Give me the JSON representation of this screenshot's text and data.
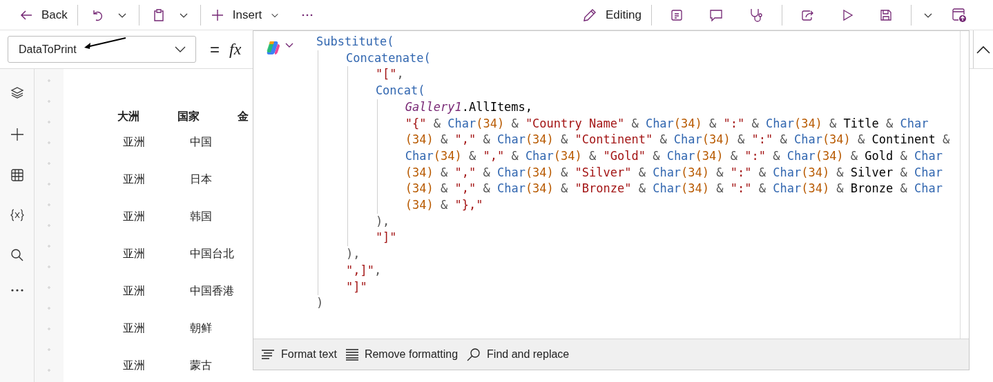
{
  "toolbar": {
    "back": "Back",
    "insert": "Insert",
    "mode": "Editing"
  },
  "formula_bar": {
    "property": "DataToPrint",
    "equals": "=",
    "fx": "fx"
  },
  "canvas": {
    "columns": [
      "大洲",
      "国家",
      "金"
    ],
    "rows": [
      [
        "亚洲",
        "中国"
      ],
      [
        "亚洲",
        "日本"
      ],
      [
        "亚洲",
        "韩国"
      ],
      [
        "亚洲",
        "中国台北"
      ],
      [
        "亚洲",
        "中国香港"
      ],
      [
        "亚洲",
        "朝鲜"
      ],
      [
        "亚洲",
        "蒙古"
      ]
    ]
  },
  "code": [
    {
      "tokens": [
        {
          "kind": "fn",
          "text": "Substitute("
        }
      ],
      "children": [
        {
          "tokens": [
            {
              "kind": "fn",
              "text": "Concatenate("
            }
          ],
          "children": [
            {
              "tokens": [
                {
                  "kind": "str",
                  "text": "\"[\""
                },
                {
                  "kind": "op",
                  "text": ","
                }
              ]
            },
            {
              "tokens": [
                {
                  "kind": "fn",
                  "text": "Concat("
                }
              ],
              "children": [
                {
                  "tokens": [
                    {
                      "kind": "ref",
                      "text": "Gallery1"
                    },
                    {
                      "kind": "plain",
                      "text": ".AllItems,"
                    }
                  ]
                },
                {
                  "tokens": [
                    {
                      "kind": "str",
                      "text": "\"{\""
                    },
                    {
                      "kind": "op",
                      "text": " & "
                    },
                    {
                      "kind": "fn",
                      "text": "Char"
                    },
                    {
                      "kind": "num",
                      "text": "(34)"
                    },
                    {
                      "kind": "op",
                      "text": " & "
                    },
                    {
                      "kind": "str",
                      "text": "\"Country Name\""
                    },
                    {
                      "kind": "op",
                      "text": " & "
                    },
                    {
                      "kind": "fn",
                      "text": "Char"
                    },
                    {
                      "kind": "num",
                      "text": "(34)"
                    },
                    {
                      "kind": "op",
                      "text": " & "
                    },
                    {
                      "kind": "str",
                      "text": "\":\""
                    },
                    {
                      "kind": "op",
                      "text": " & "
                    },
                    {
                      "kind": "fn",
                      "text": "Char"
                    },
                    {
                      "kind": "num",
                      "text": "(34)"
                    },
                    {
                      "kind": "op",
                      "text": " & "
                    },
                    {
                      "kind": "plain",
                      "text": "Title"
                    },
                    {
                      "kind": "op",
                      "text": " & "
                    },
                    {
                      "kind": "fn",
                      "text": "Char"
                    },
                    {
                      "kind": "num",
                      "text": "(34)"
                    },
                    {
                      "kind": "op",
                      "text": " & "
                    },
                    {
                      "kind": "str",
                      "text": "\",\""
                    },
                    {
                      "kind": "op",
                      "text": " & "
                    },
                    {
                      "kind": "fn",
                      "text": "Char"
                    },
                    {
                      "kind": "num",
                      "text": "(34)"
                    },
                    {
                      "kind": "op",
                      "text": " & "
                    },
                    {
                      "kind": "str",
                      "text": "\"Continent\""
                    },
                    {
                      "kind": "op",
                      "text": " & "
                    },
                    {
                      "kind": "fn",
                      "text": "Char"
                    },
                    {
                      "kind": "num",
                      "text": "(34)"
                    },
                    {
                      "kind": "op",
                      "text": " & "
                    },
                    {
                      "kind": "str",
                      "text": "\":\""
                    },
                    {
                      "kind": "op",
                      "text": " & "
                    },
                    {
                      "kind": "fn",
                      "text": "Char"
                    },
                    {
                      "kind": "num",
                      "text": "(34)"
                    },
                    {
                      "kind": "op",
                      "text": " & "
                    },
                    {
                      "kind": "plain",
                      "text": "Continent"
                    },
                    {
                      "kind": "op",
                      "text": " & "
                    },
                    {
                      "kind": "fn",
                      "text": "Char"
                    },
                    {
                      "kind": "num",
                      "text": "(34)"
                    },
                    {
                      "kind": "op",
                      "text": " & "
                    },
                    {
                      "kind": "str",
                      "text": "\",\""
                    },
                    {
                      "kind": "op",
                      "text": " & "
                    },
                    {
                      "kind": "fn",
                      "text": "Char"
                    },
                    {
                      "kind": "num",
                      "text": "(34)"
                    },
                    {
                      "kind": "op",
                      "text": " & "
                    },
                    {
                      "kind": "str",
                      "text": "\"Gold\""
                    },
                    {
                      "kind": "op",
                      "text": " & "
                    },
                    {
                      "kind": "fn",
                      "text": "Char"
                    },
                    {
                      "kind": "num",
                      "text": "(34)"
                    },
                    {
                      "kind": "op",
                      "text": " & "
                    },
                    {
                      "kind": "str",
                      "text": "\":\""
                    },
                    {
                      "kind": "op",
                      "text": " & "
                    },
                    {
                      "kind": "fn",
                      "text": "Char"
                    },
                    {
                      "kind": "num",
                      "text": "(34)"
                    },
                    {
                      "kind": "op",
                      "text": " & "
                    },
                    {
                      "kind": "plain",
                      "text": "Gold"
                    },
                    {
                      "kind": "op",
                      "text": " & "
                    },
                    {
                      "kind": "fn",
                      "text": "Char"
                    },
                    {
                      "kind": "num",
                      "text": "(34)"
                    },
                    {
                      "kind": "op",
                      "text": " & "
                    },
                    {
                      "kind": "str",
                      "text": "\",\""
                    },
                    {
                      "kind": "op",
                      "text": " & "
                    },
                    {
                      "kind": "fn",
                      "text": "Char"
                    },
                    {
                      "kind": "num",
                      "text": "(34)"
                    },
                    {
                      "kind": "op",
                      "text": " & "
                    },
                    {
                      "kind": "str",
                      "text": "\"Silver\""
                    },
                    {
                      "kind": "op",
                      "text": " & "
                    },
                    {
                      "kind": "fn",
                      "text": "Char"
                    },
                    {
                      "kind": "num",
                      "text": "(34)"
                    },
                    {
                      "kind": "op",
                      "text": " & "
                    },
                    {
                      "kind": "str",
                      "text": "\":\""
                    },
                    {
                      "kind": "op",
                      "text": " & "
                    },
                    {
                      "kind": "fn",
                      "text": "Char"
                    },
                    {
                      "kind": "num",
                      "text": "(34)"
                    },
                    {
                      "kind": "op",
                      "text": " & "
                    },
                    {
                      "kind": "plain",
                      "text": "Silver"
                    },
                    {
                      "kind": "op",
                      "text": " & "
                    },
                    {
                      "kind": "fn",
                      "text": "Char"
                    },
                    {
                      "kind": "num",
                      "text": "(34)"
                    },
                    {
                      "kind": "op",
                      "text": " & "
                    },
                    {
                      "kind": "str",
                      "text": "\",\""
                    },
                    {
                      "kind": "op",
                      "text": " & "
                    },
                    {
                      "kind": "fn",
                      "text": "Char"
                    },
                    {
                      "kind": "num",
                      "text": "(34)"
                    },
                    {
                      "kind": "op",
                      "text": " & "
                    },
                    {
                      "kind": "str",
                      "text": "\"Bronze\""
                    },
                    {
                      "kind": "op",
                      "text": " & "
                    },
                    {
                      "kind": "fn",
                      "text": "Char"
                    },
                    {
                      "kind": "num",
                      "text": "(34)"
                    },
                    {
                      "kind": "op",
                      "text": " & "
                    },
                    {
                      "kind": "str",
                      "text": "\":\""
                    },
                    {
                      "kind": "op",
                      "text": " & "
                    },
                    {
                      "kind": "fn",
                      "text": "Char"
                    },
                    {
                      "kind": "num",
                      "text": "(34)"
                    },
                    {
                      "kind": "op",
                      "text": " & "
                    },
                    {
                      "kind": "plain",
                      "text": "Bronze"
                    },
                    {
                      "kind": "op",
                      "text": " & "
                    },
                    {
                      "kind": "fn",
                      "text": "Char"
                    },
                    {
                      "kind": "num",
                      "text": "(34)"
                    },
                    {
                      "kind": "op",
                      "text": " & "
                    },
                    {
                      "kind": "str",
                      "text": "\"},\""
                    }
                  ]
                }
              ]
            },
            {
              "tokens": [
                {
                  "kind": "op",
                  "text": "),"
                }
              ]
            },
            {
              "tokens": [
                {
                  "kind": "str",
                  "text": "\"]\""
                }
              ]
            }
          ]
        },
        {
          "tokens": [
            {
              "kind": "op",
              "text": "),"
            }
          ]
        },
        {
          "tokens": [
            {
              "kind": "str",
              "text": "\",]\""
            },
            {
              "kind": "op",
              "text": ","
            }
          ]
        },
        {
          "tokens": [
            {
              "kind": "str",
              "text": "\"]\""
            }
          ]
        }
      ]
    },
    {
      "tokens": [
        {
          "kind": "op",
          "text": ")"
        }
      ]
    }
  ],
  "editor_actions": [
    "Format text",
    "Remove formatting",
    "Find and replace"
  ]
}
